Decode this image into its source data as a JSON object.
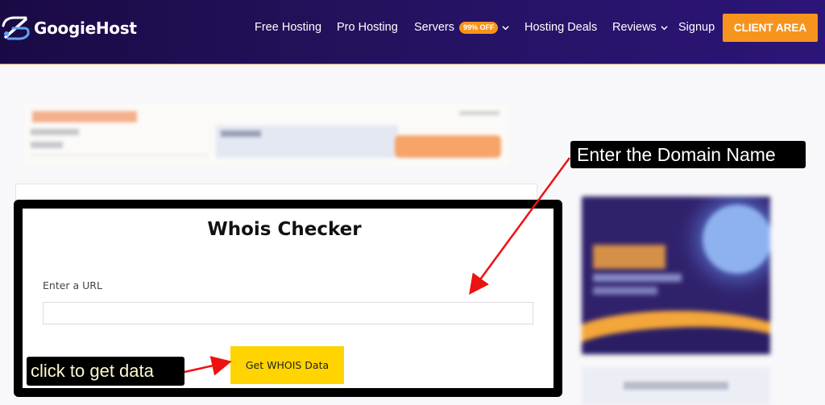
{
  "header": {
    "logo_text": "GoogieHost",
    "nav": [
      {
        "label": "Free Hosting"
      },
      {
        "label": "Pro Hosting"
      },
      {
        "label": "Servers",
        "badge": "99% OFF"
      },
      {
        "label": "Hosting Deals"
      },
      {
        "label": "Reviews"
      },
      {
        "label": "Signup"
      }
    ],
    "client_area_label": "CLIENT AREA"
  },
  "tool": {
    "title": "Whois Checker",
    "url_label": "Enter a URL",
    "url_value": "",
    "url_placeholder": "",
    "submit_label": "Get WHOIS Data"
  },
  "annotations": {
    "domain_callout": "Enter the Domain Name",
    "click_callout": "click to get data"
  },
  "colors": {
    "header_bg": "#24125e",
    "accent_orange": "#f7941d",
    "button_yellow": "#ffd400",
    "arrow_red": "#ee1111"
  }
}
